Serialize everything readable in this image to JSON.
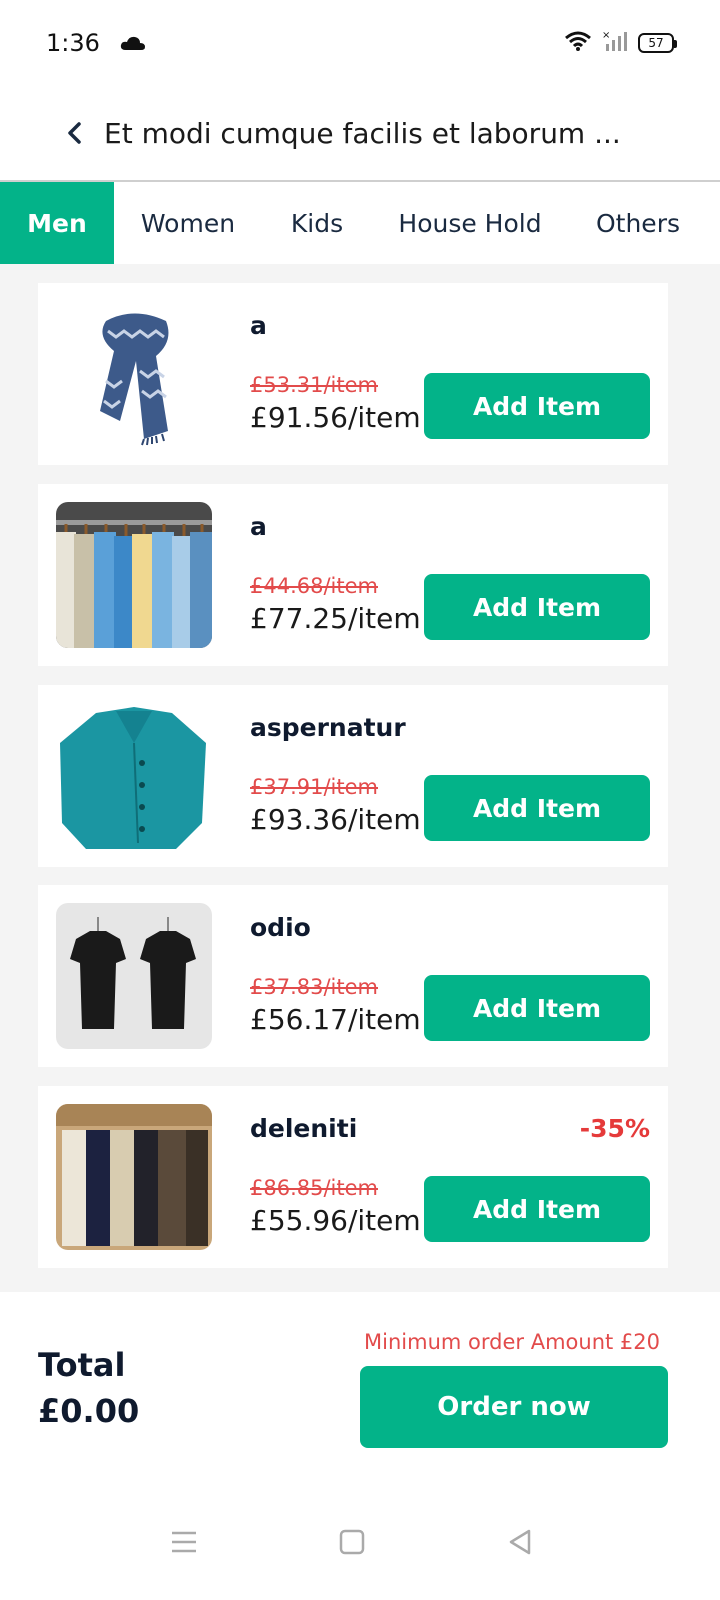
{
  "status_bar": {
    "time": "1:36",
    "battery": "57",
    "icons": [
      "cloud-icon",
      "wifi-icon",
      "signal-icon",
      "battery-icon"
    ]
  },
  "header": {
    "title": "Et modi cumque facilis et laborum ..."
  },
  "tabs": [
    {
      "label": "Men",
      "active": true
    },
    {
      "label": "Women",
      "active": false
    },
    {
      "label": "Kids",
      "active": false
    },
    {
      "label": "House Hold",
      "active": false
    },
    {
      "label": "Others",
      "active": false
    }
  ],
  "products": [
    {
      "name": "a",
      "old_price": "£53.31/item",
      "price": "£91.56/item",
      "discount": "",
      "button": "Add Item",
      "image": "scarf"
    },
    {
      "name": "a",
      "old_price": "£44.68/item",
      "price": "£77.25/item",
      "discount": "",
      "button": "Add Item",
      "image": "shirts-rack"
    },
    {
      "name": "aspernatur",
      "old_price": "£37.91/item",
      "price": "£93.36/item",
      "discount": "",
      "button": "Add Item",
      "image": "teal-jacket"
    },
    {
      "name": "odio",
      "old_price": "£37.83/item",
      "price": "£56.17/item",
      "discount": "",
      "button": "Add Item",
      "image": "black-tshirts"
    },
    {
      "name": "deleniti",
      "old_price": "£86.85/item",
      "price": "£55.96/item",
      "discount": "-35%",
      "button": "Add Item",
      "image": "trousers"
    }
  ],
  "footer": {
    "total_label": "Total",
    "total_value": "£0.00",
    "min_order": "Minimum order Amount £20",
    "order_button": "Order now"
  },
  "colors": {
    "accent": "#03b389",
    "sale_red": "#e24b4b",
    "text_dark": "#0f1a2e"
  }
}
